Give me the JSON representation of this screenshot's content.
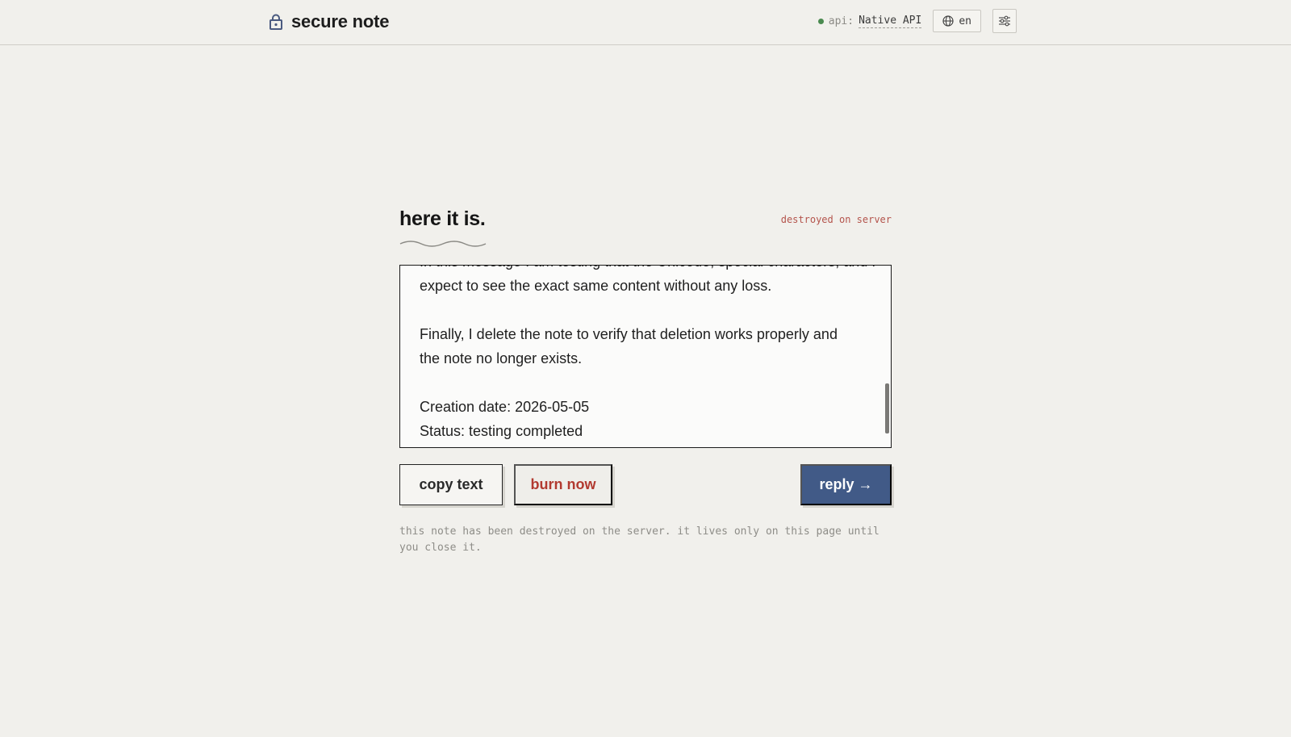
{
  "header": {
    "brand_icon": "lock-icon",
    "title": "secure note",
    "api": {
      "status_color": "#4a8a4f",
      "label": "api:",
      "value": "Native API"
    },
    "language": {
      "icon": "globe-icon",
      "value": "en"
    },
    "settings_icon": "sliders-icon"
  },
  "main": {
    "heading": "here it is.",
    "status_tag": "destroyed on server",
    "note_lines": [
      "In this message I am testing that the Unicode, special characters, and I",
      "expect to see the exact same content without any loss.",
      "",
      "Finally, I delete the note to verify that deletion works properly and",
      "the note no longer exists.",
      "",
      "Creation date: 2026-05-05",
      "Status: testing completed"
    ],
    "buttons": {
      "copy": "copy text",
      "burn": "burn now",
      "reply": "reply →"
    },
    "footnote": "this note has been destroyed on the server. it lives only on this page until you close it."
  },
  "colors": {
    "background": "#f1f0ec",
    "accent": "#415a87",
    "danger": "#b23a30"
  }
}
